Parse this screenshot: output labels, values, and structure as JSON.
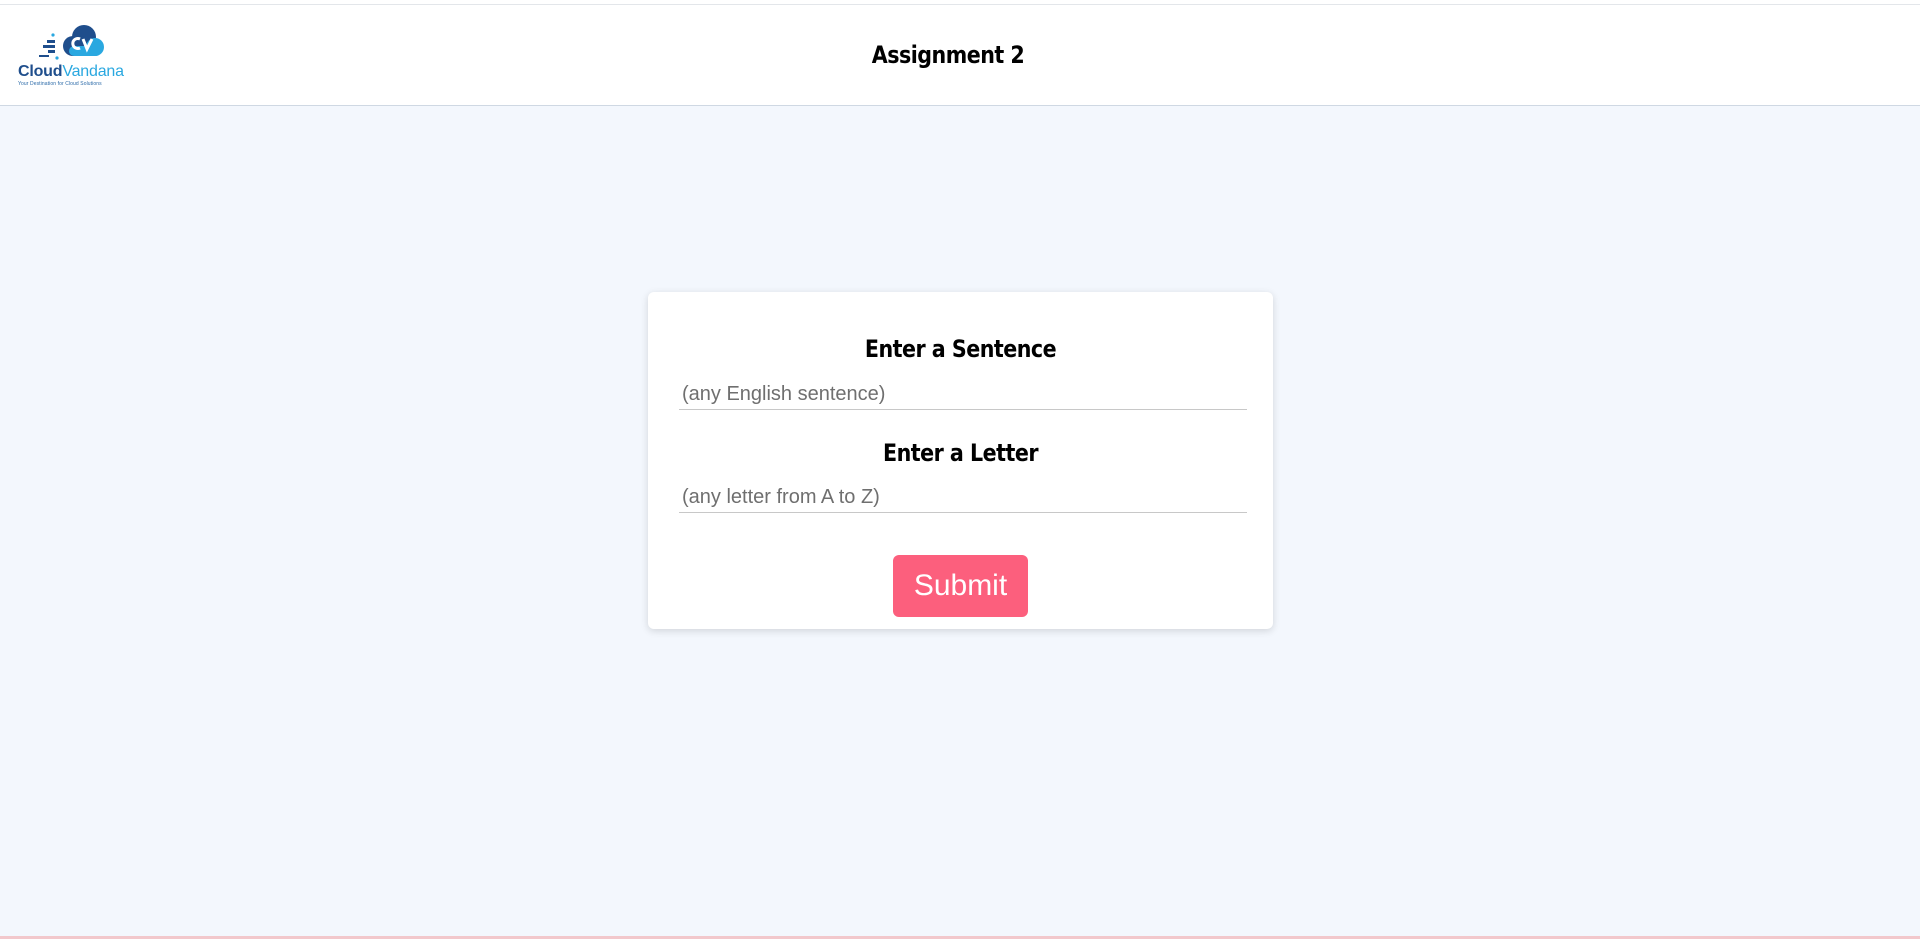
{
  "header": {
    "logo": {
      "word_dark": "Cloud",
      "word_light": "Vandana",
      "tagline": "Your Destination for Cloud Solutions",
      "colors": {
        "dark": "#1f4e8c",
        "light": "#2aa8e0"
      }
    },
    "title": "Assignment 2"
  },
  "form": {
    "sentence_label": "Enter a Sentence",
    "sentence_placeholder": "(any English sentence)",
    "sentence_value": "",
    "letter_label": "Enter a Letter",
    "letter_placeholder": "(any letter from A to Z)",
    "letter_value": "",
    "submit_label": "Submit"
  },
  "colors": {
    "page_background": "#f3f7fd",
    "submit_button": "#fc5f7d"
  }
}
